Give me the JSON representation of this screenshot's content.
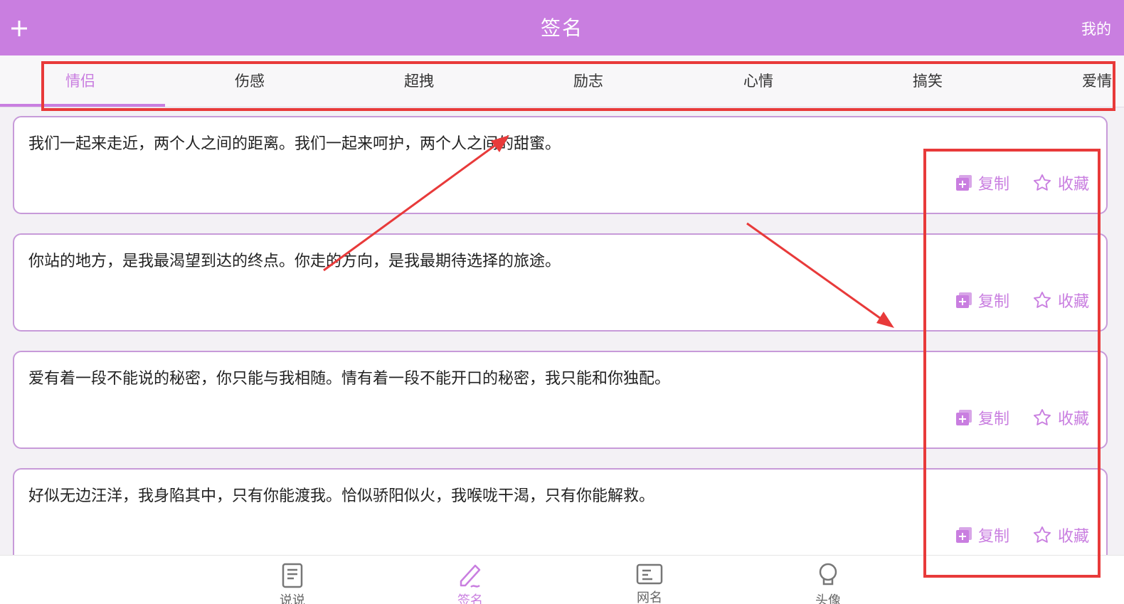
{
  "header": {
    "title": "签名",
    "add_icon": "plus-icon",
    "right_label": "我的"
  },
  "tabs": [
    {
      "label": "情侣",
      "active": true
    },
    {
      "label": "伤感"
    },
    {
      "label": "超拽"
    },
    {
      "label": "励志"
    },
    {
      "label": "心情"
    },
    {
      "label": "搞笑"
    },
    {
      "label": "爱情"
    }
  ],
  "actions": {
    "copy_label": "复制",
    "copy_icon": "copy-plus-icon",
    "fav_label": "收藏",
    "fav_icon": "star-outline-icon"
  },
  "cards": [
    {
      "text": "我们一起来走近，两个人之间的距离。我们一起来呵护，两个人之间的甜蜜。"
    },
    {
      "text": "你站的地方，是我最渴望到达的终点。你走的方向，是我最期待选择的旅途。"
    },
    {
      "text": "爱有着一段不能说的秘密，你只能与我相随。情有着一段不能开口的秘密，我只能和你独配。"
    },
    {
      "text": "好似无边汪洋，我身陷其中，只有你能渡我。恰似骄阳似火，我喉咙干渴，只有你能解救。"
    }
  ],
  "bottom_nav": [
    {
      "label": "说说",
      "icon": "document-icon"
    },
    {
      "label": "签名",
      "icon": "pen-signature-icon",
      "active": true
    },
    {
      "label": "网名",
      "icon": "id-card-icon"
    },
    {
      "label": "头像",
      "icon": "avatar-icon"
    }
  ],
  "colors": {
    "accent": "#c97ee0",
    "annotation": "#e83a3a"
  }
}
